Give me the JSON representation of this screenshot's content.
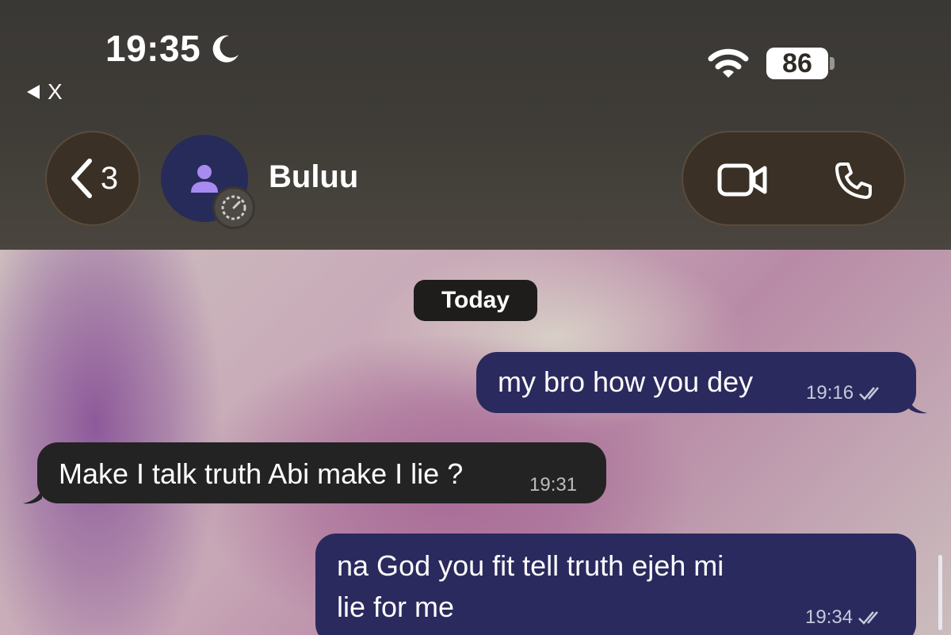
{
  "status_bar": {
    "time": "19:35",
    "back_app_label": "X",
    "battery": "86",
    "icons": [
      "moon-icon",
      "wifi-icon",
      "battery-icon"
    ]
  },
  "header": {
    "back_count": "3",
    "contact_name": "Buluu",
    "icons": [
      "chevron-left-icon",
      "person-icon",
      "timer-icon",
      "video-call-icon",
      "phone-icon"
    ]
  },
  "chat": {
    "date_label": "Today",
    "messages": [
      {
        "direction": "outgoing",
        "text": "my bro how you dey",
        "time": "19:16",
        "status": "read"
      },
      {
        "direction": "incoming",
        "text": "Make I talk truth Abi make I lie ?",
        "time": "19:31"
      },
      {
        "direction": "outgoing",
        "text_line1": "na God you fit tell truth ejeh mi",
        "text_line2": "lie for me",
        "time": "19:34",
        "status": "read"
      }
    ]
  },
  "colors": {
    "outgoing_bubble": "#2a2a5e",
    "incoming_bubble": "#232323",
    "avatar_bg": "#262b5a",
    "avatar_icon": "#a78bf0"
  }
}
